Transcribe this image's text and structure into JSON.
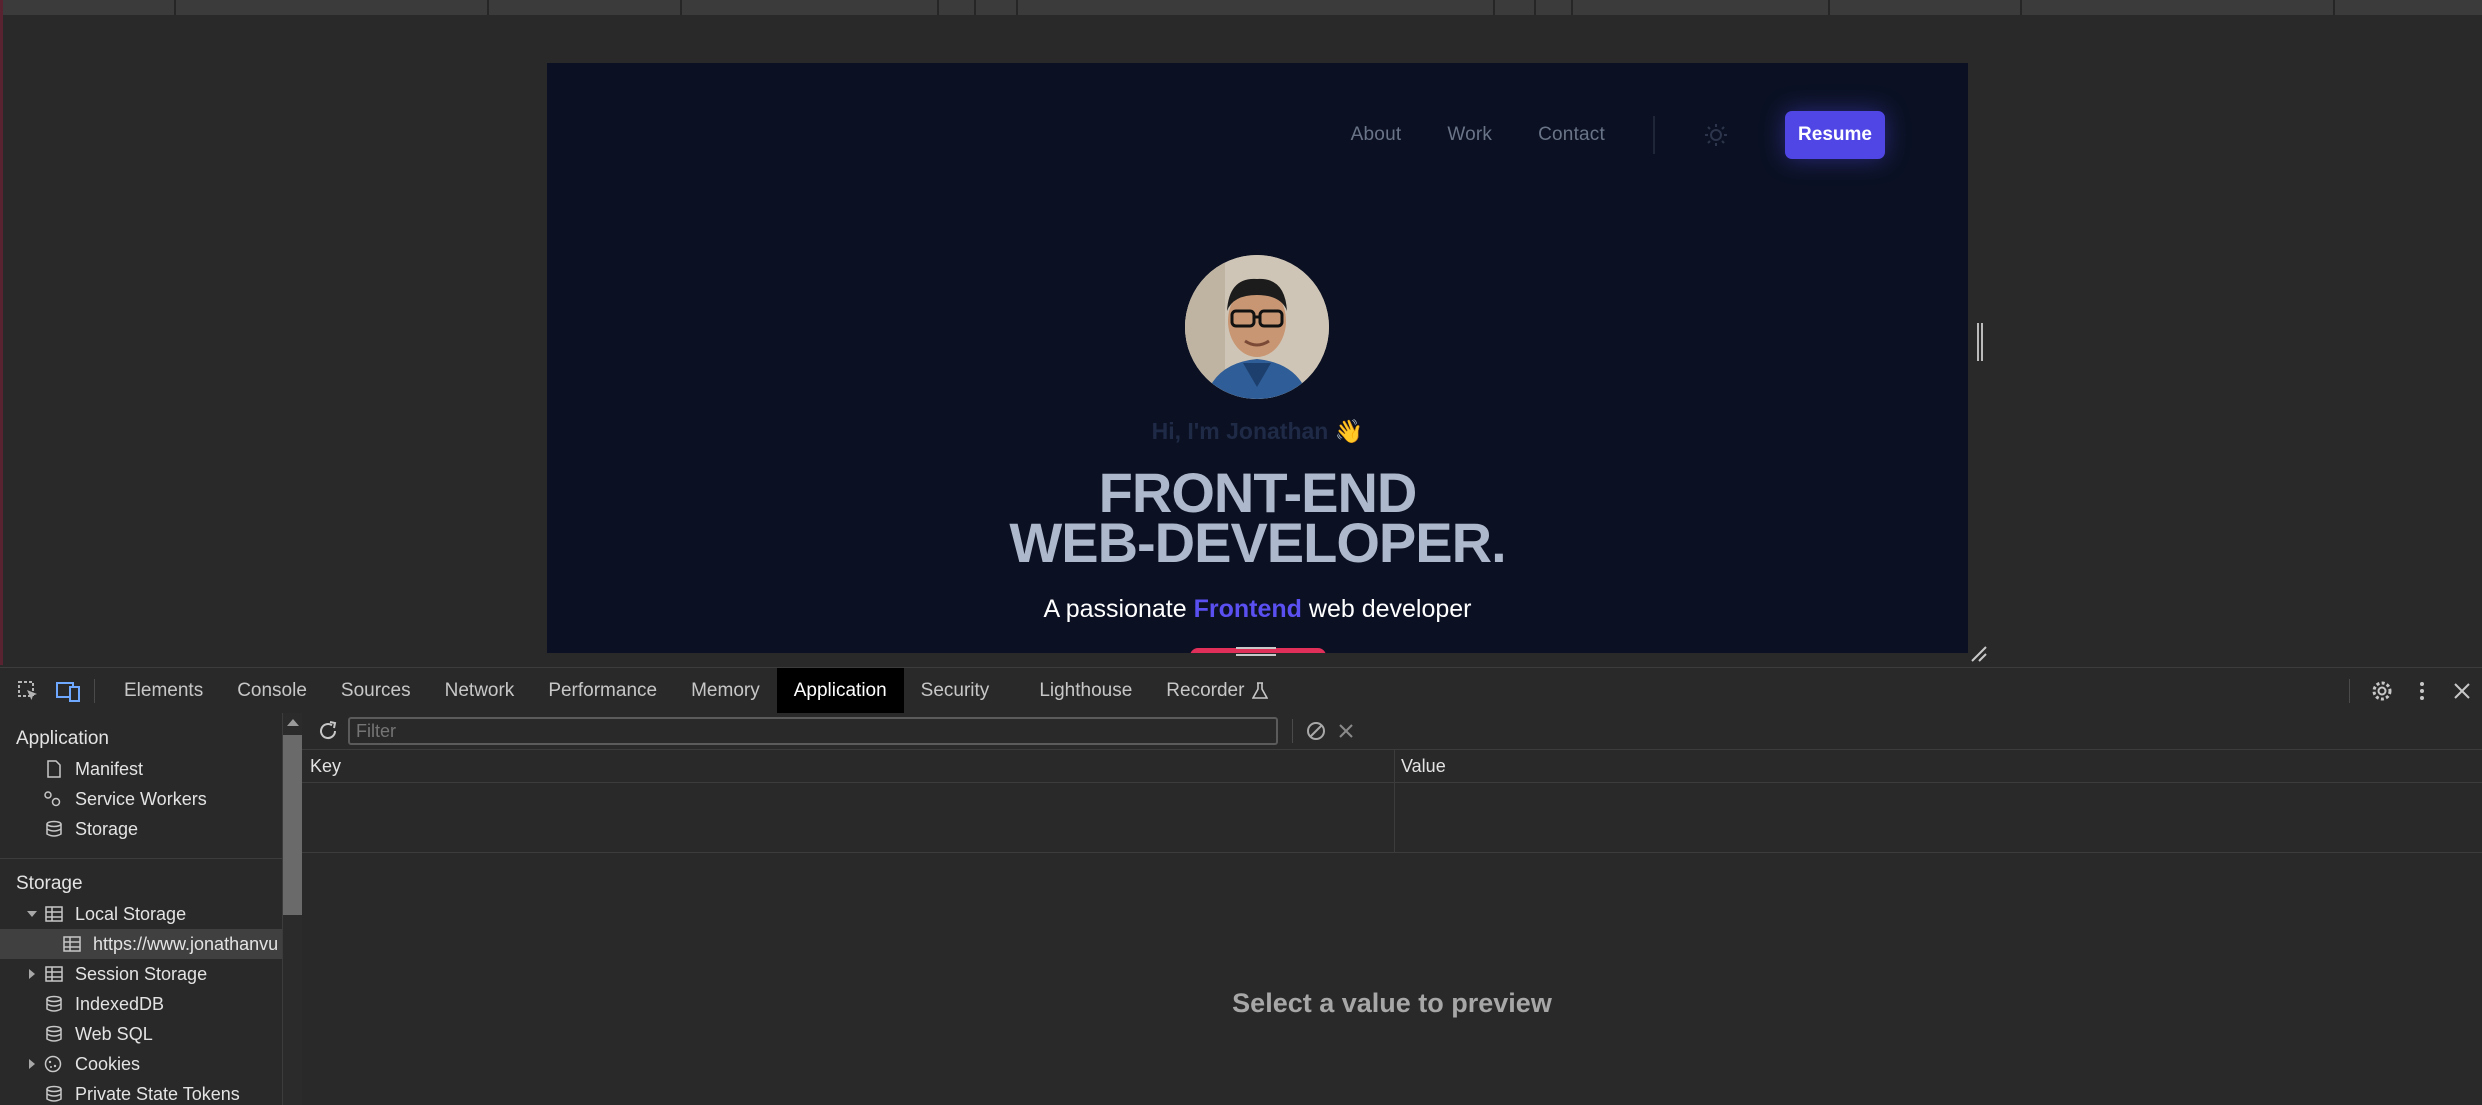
{
  "site": {
    "nav": {
      "about": "About",
      "work": "Work",
      "contact": "Contact",
      "resume": "Resume"
    },
    "greeting": "Hi, I'm Jonathan",
    "greeting_emoji": "👋",
    "headline_line1": "FRONT-END",
    "headline_line2": "WEB-DEVELOPER.",
    "tagline_before": "A passionate",
    "tagline_accent": "Frontend",
    "tagline_after": "web developer",
    "colors": {
      "background": "#0b1123",
      "accent": "#4f46e5",
      "headline": "#aeb8cc",
      "cta": "#e0305a"
    }
  },
  "devtools": {
    "tabs": [
      "Elements",
      "Console",
      "Sources",
      "Network",
      "Performance",
      "Memory",
      "Application",
      "Security",
      "Lighthouse",
      "Recorder"
    ],
    "active_tab": "Application",
    "sidebar": {
      "application_header": "Application",
      "application_items": [
        {
          "label": "Manifest",
          "icon": "document-icon"
        },
        {
          "label": "Service Workers",
          "icon": "gears-icon"
        },
        {
          "label": "Storage",
          "icon": "database-icon"
        }
      ],
      "storage_header": "Storage",
      "storage_items": [
        {
          "label": "Local Storage",
          "icon": "table-icon",
          "expanded": true
        },
        {
          "label": "https://www.jonathanvu",
          "icon": "table-icon",
          "selected": true
        },
        {
          "label": "Session Storage",
          "icon": "table-icon",
          "expanded": false
        },
        {
          "label": "IndexedDB",
          "icon": "database-icon"
        },
        {
          "label": "Web SQL",
          "icon": "database-icon"
        },
        {
          "label": "Cookies",
          "icon": "cookie-icon",
          "expanded": false
        },
        {
          "label": "Private State Tokens",
          "icon": "database-icon"
        }
      ]
    },
    "main": {
      "filter_placeholder": "Filter",
      "columns": {
        "key": "Key",
        "value": "Value"
      },
      "preview_message": "Select a value to preview"
    }
  }
}
